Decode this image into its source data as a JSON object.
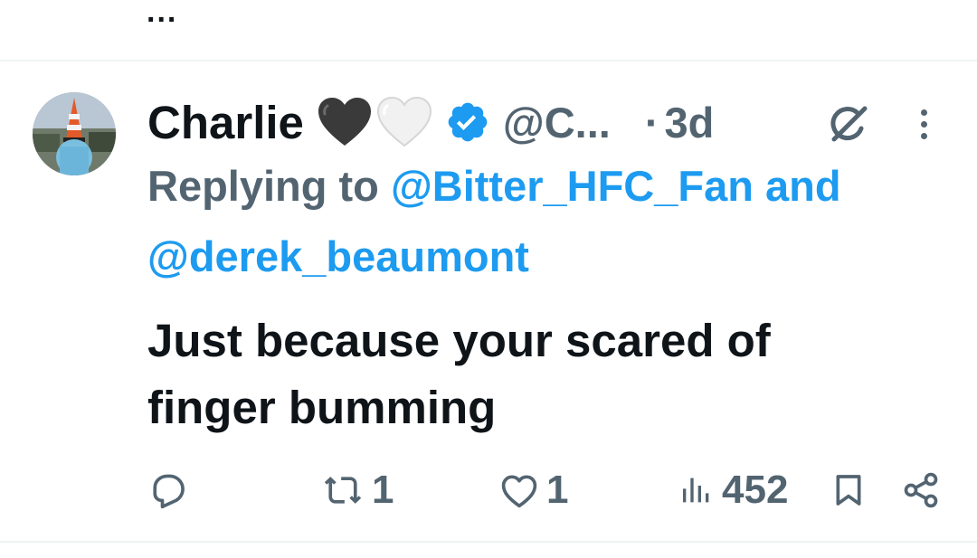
{
  "previous_tweet": {
    "ellipsis": "..."
  },
  "tweet": {
    "author": {
      "display_name": "Charlie",
      "handle": "@C...",
      "verified": true,
      "emoji_hearts": [
        "black-heart-icon",
        "white-heart-icon"
      ]
    },
    "separator": "·",
    "timestamp": "3d",
    "replying_to": {
      "prefix": "Replying to",
      "user1": "@Bitter_HFC_Fan",
      "conjunction": "and",
      "user2": "@derek_beaumont"
    },
    "text_lines": [
      "Just because your scared of",
      "finger bumming"
    ],
    "metrics": {
      "replies": "",
      "retweets": "1",
      "likes": "1",
      "views": "452"
    }
  },
  "colors": {
    "text": "#0f1419",
    "muted": "#536471",
    "accent": "#1d9bf0",
    "divider": "#eff3f4"
  }
}
